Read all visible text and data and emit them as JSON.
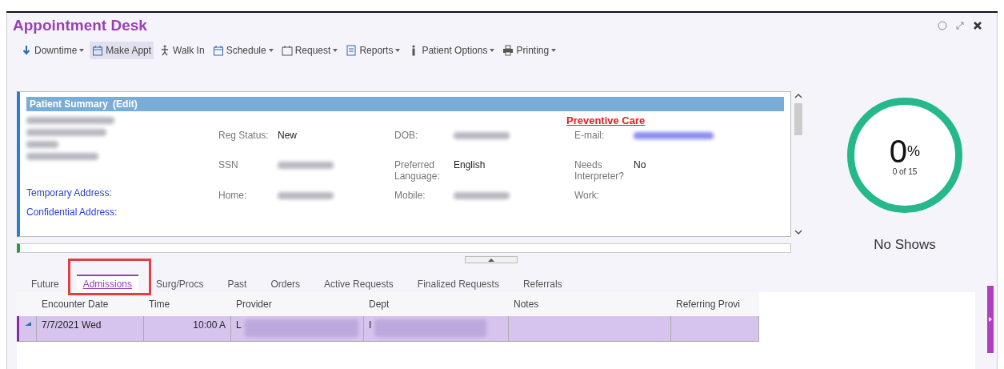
{
  "window": {
    "title": "Appointment Desk"
  },
  "toolbar": [
    {
      "label": "Downtime",
      "dropdown": true,
      "selected": false
    },
    {
      "label": "Make Appt",
      "dropdown": false,
      "selected": true
    },
    {
      "label": "Walk In",
      "dropdown": false,
      "selected": false
    },
    {
      "label": "Schedule",
      "dropdown": true,
      "selected": false
    },
    {
      "label": "Request",
      "dropdown": true,
      "selected": false
    },
    {
      "label": "Reports",
      "dropdown": true,
      "selected": false
    },
    {
      "label": "Patient Options",
      "dropdown": true,
      "selected": false
    },
    {
      "label": "Printing",
      "dropdown": true,
      "selected": false
    }
  ],
  "patient_summary": {
    "header": "Patient Summary",
    "edit_link": "(Edit)",
    "preventive_care": "Preventive Care",
    "fields": [
      {
        "label": "Reg Status:",
        "value": "New"
      },
      {
        "label": "DOB:",
        "blurred": true
      },
      {
        "label": "E-mail:",
        "blurred": true,
        "kind": "link"
      },
      {
        "label": "SSN",
        "blurred": true
      },
      {
        "label": "Preferred Language:",
        "value": "English"
      },
      {
        "label": "Needs Interpreter?",
        "value": "No"
      },
      {
        "label": "Home:",
        "blurred": true
      },
      {
        "label": "Mobile:",
        "blurred": true
      },
      {
        "label": "Work:"
      }
    ],
    "links": [
      "Temporary Address:",
      "Confidential Address:"
    ]
  },
  "gauge": {
    "value": "0",
    "unit": "%",
    "caption": "0 of 15",
    "label": "No Shows"
  },
  "tabs": [
    {
      "label": "Future",
      "selected": false
    },
    {
      "label": "Admissions",
      "selected": true
    },
    {
      "label": "Surg/Procs",
      "selected": false
    },
    {
      "label": "Past",
      "selected": false
    },
    {
      "label": "Orders",
      "selected": false
    },
    {
      "label": "Active Requests",
      "selected": false
    },
    {
      "label": "Finalized Requests",
      "selected": false
    },
    {
      "label": "Referrals",
      "selected": false
    }
  ],
  "table": {
    "columns": [
      "Encounter Date",
      "Time",
      "Provider",
      "Dept",
      "Notes",
      "Referring Provi"
    ],
    "rows": [
      {
        "selected": true,
        "cells": [
          "7/7/2021 Wed",
          "10:00 A",
          "L",
          "I",
          "",
          ""
        ]
      }
    ]
  }
}
